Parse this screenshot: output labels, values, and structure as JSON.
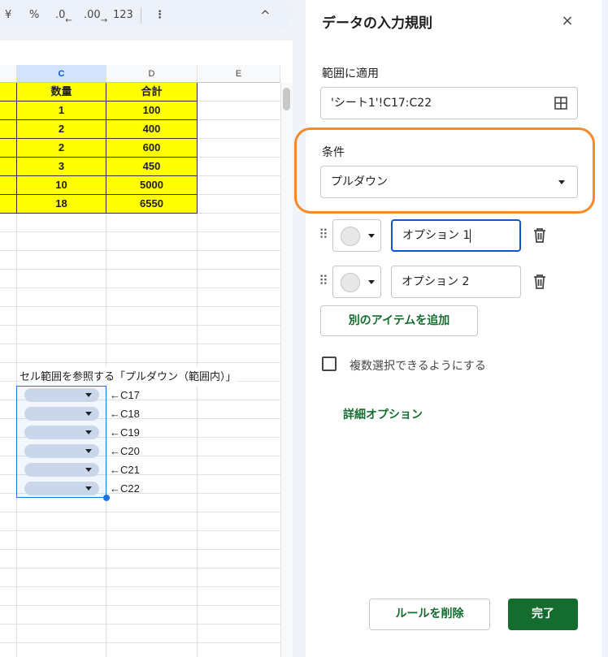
{
  "toolbar": {
    "items": [
      "¥",
      "%",
      ".0",
      ".00",
      "123",
      "⋮",
      "^"
    ]
  },
  "sheet": {
    "columns": [
      "C",
      "D",
      "E"
    ],
    "table_rows": [
      [
        "数量",
        "合計"
      ],
      [
        "1",
        "100"
      ],
      [
        "2",
        "400"
      ],
      [
        "2",
        "600"
      ],
      [
        "3",
        "450"
      ],
      [
        "10",
        "5000"
      ],
      [
        "18",
        "6550"
      ]
    ],
    "note": "セル範囲を参照する「プルダウン（範囲内）」",
    "dropdown_refs": [
      "←C17",
      "←C18",
      "←C19",
      "←C20",
      "←C21",
      "←C22"
    ]
  },
  "panel": {
    "title": "データの入力規則",
    "close": "×",
    "range_label": "範囲に適用",
    "range_value": "'シート1'!C17:C22",
    "criteria_label": "条件",
    "criteria_value": "プルダウン",
    "options": [
      {
        "value": "オプション 1"
      },
      {
        "value": "オプション 2"
      }
    ],
    "add_item": "別のアイテムを追加",
    "multi_select": "複数選択できるようにする",
    "advanced": "詳細オプション",
    "delete_rule": "ルールを削除",
    "done": "完了"
  },
  "colors": {
    "highlight": "#ffff00",
    "accent": "#146c2e",
    "outline": "#f58a2b"
  }
}
